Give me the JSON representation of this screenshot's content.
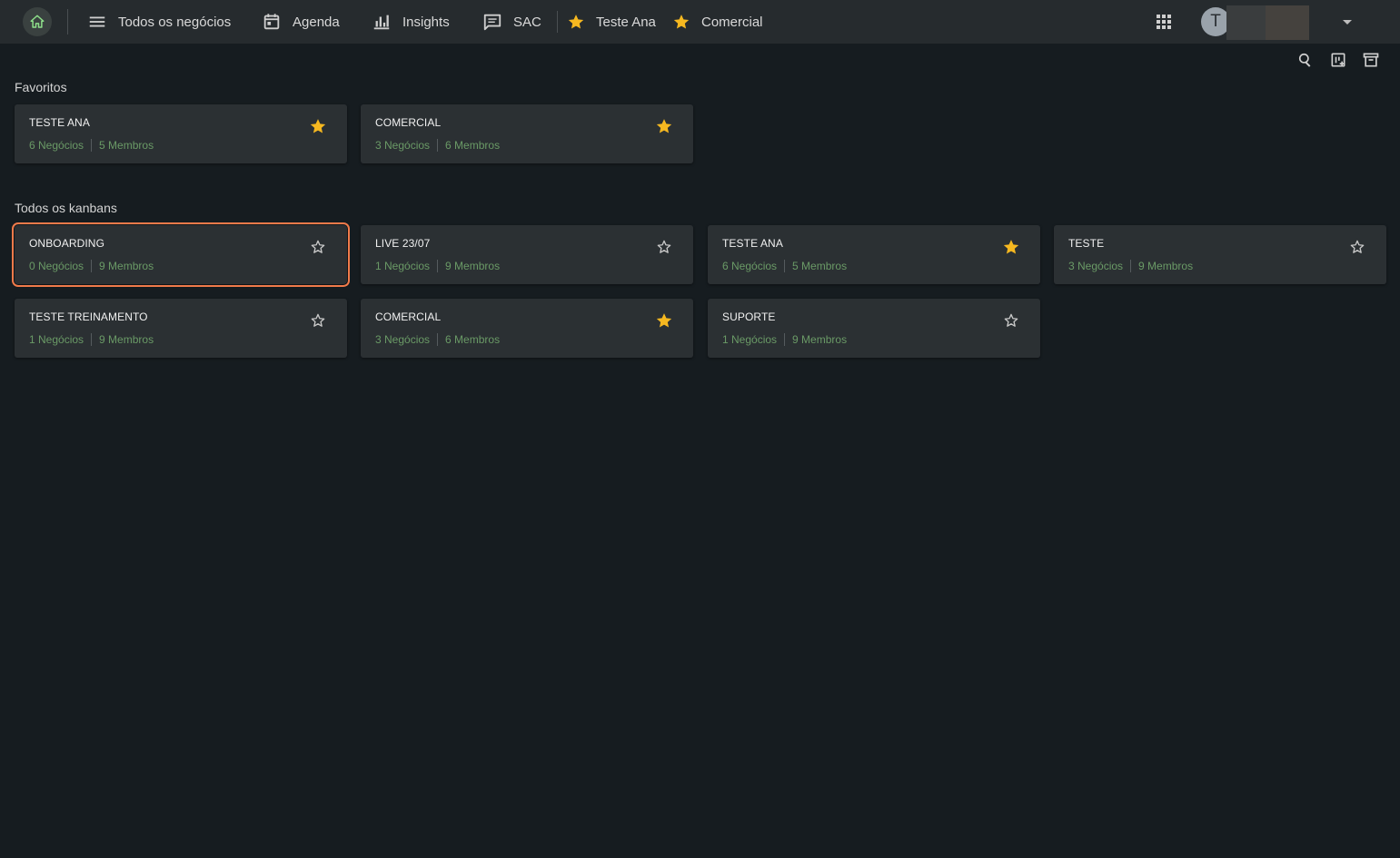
{
  "topbar": {
    "nav": [
      {
        "label": "Todos os negócios",
        "icon": "menu-icon"
      },
      {
        "label": "Agenda",
        "icon": "calendar-icon"
      },
      {
        "label": "Insights",
        "icon": "bar-chart-icon"
      },
      {
        "label": "SAC",
        "icon": "chat-icon"
      },
      {
        "label": "Teste Ana",
        "icon": "star-filled-icon"
      },
      {
        "label": "Comercial",
        "icon": "star-filled-icon"
      }
    ],
    "avatar_initial": "T"
  },
  "colors": {
    "accent_star": "#f6b820",
    "meta_text": "#6a9a66",
    "selected_outline": "#f07a4a",
    "card_bg": "#2b3033",
    "page_bg": "#161c20"
  },
  "sections": {
    "favorites_title": "Favoritos",
    "all_title": "Todos os kanbans"
  },
  "favorites": [
    {
      "title": "TESTE ANA",
      "deals": "6 Negócios",
      "members": "5 Membros",
      "starred": true
    },
    {
      "title": "COMERCIAL",
      "deals": "3 Negócios",
      "members": "6 Membros",
      "starred": true
    }
  ],
  "kanbans": [
    {
      "title": "ONBOARDING",
      "deals": "0 Negócios",
      "members": "9 Membros",
      "starred": false,
      "selected": true
    },
    {
      "title": "LIVE 23/07",
      "deals": "1 Negócios",
      "members": "9 Membros",
      "starred": false
    },
    {
      "title": "TESTE ANA",
      "deals": "6 Negócios",
      "members": "5 Membros",
      "starred": true
    },
    {
      "title": "TESTE",
      "deals": "3 Negócios",
      "members": "9 Membros",
      "starred": false
    },
    {
      "title": "TESTE TREINAMENTO",
      "deals": "1 Negócios",
      "members": "9 Membros",
      "starred": false
    },
    {
      "title": "COMERCIAL",
      "deals": "3 Negócios",
      "members": "6 Membros",
      "starred": true
    },
    {
      "title": "SUPORTE",
      "deals": "1 Negócios",
      "members": "9 Membros",
      "starred": false
    }
  ]
}
